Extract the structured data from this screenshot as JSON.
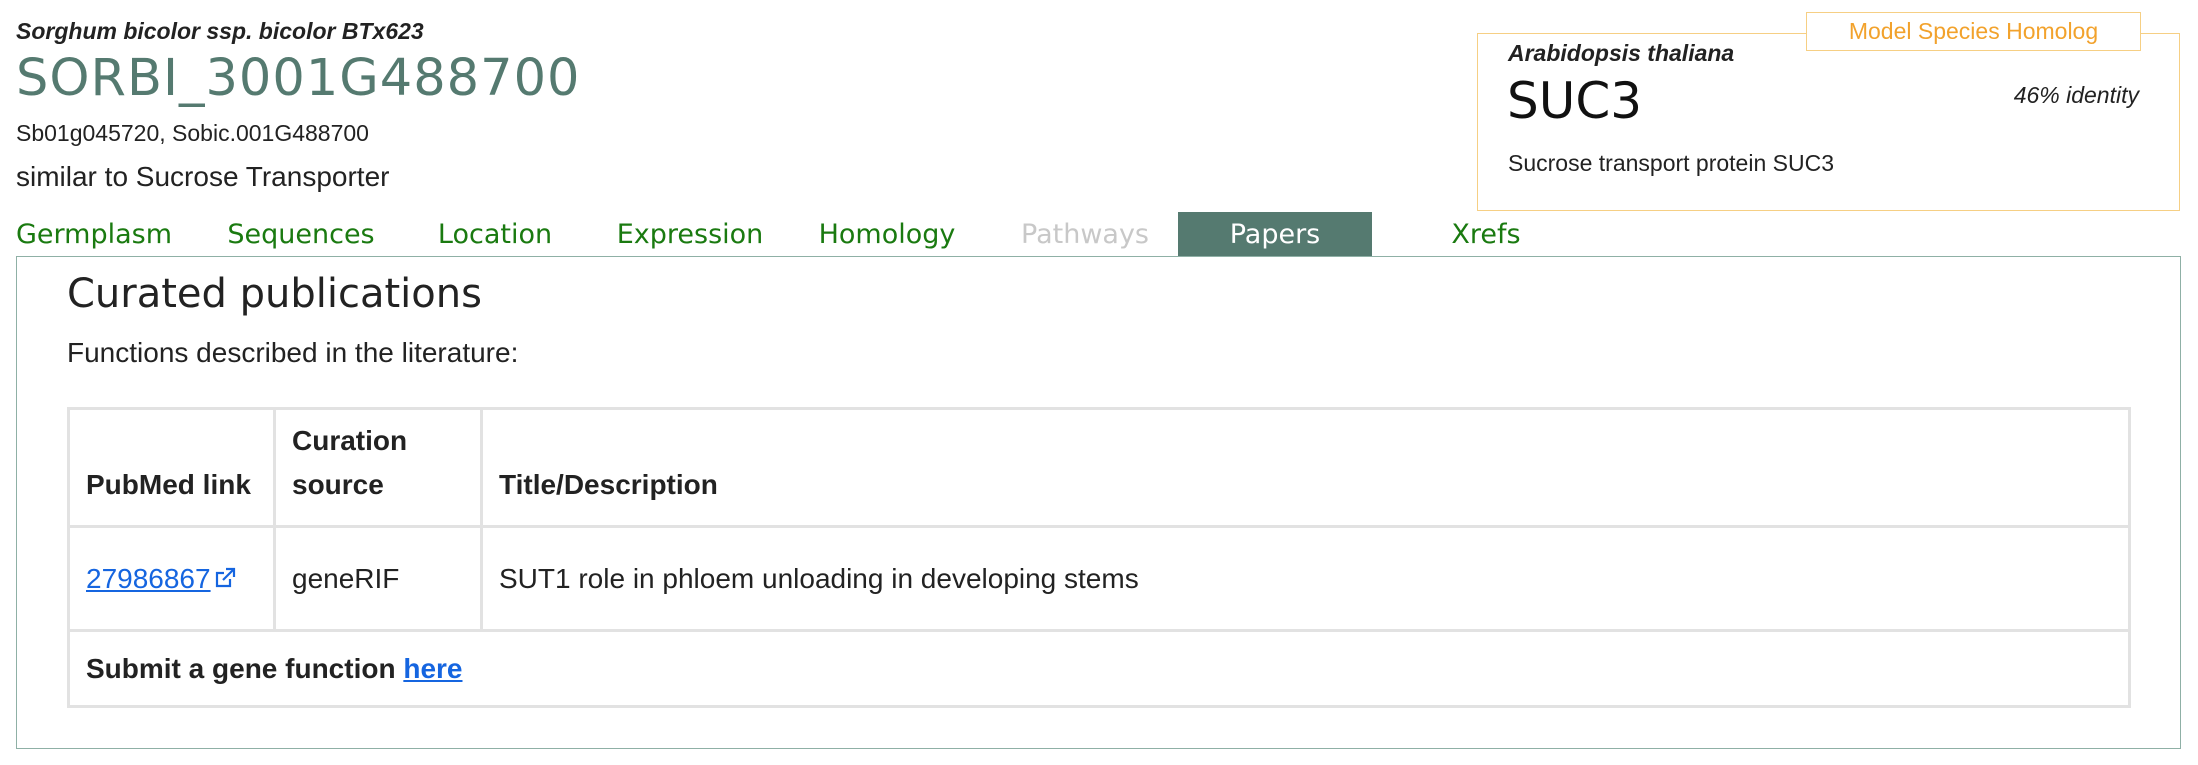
{
  "gene": {
    "species": "Sorghum bicolor ssp. bicolor BTx623",
    "id": "SORBI_3001G488700",
    "synonyms": "Sb01g045720, Sobic.001G488700",
    "summary": "similar to Sucrose Transporter"
  },
  "homolog": {
    "label": "Model Species Homolog",
    "species": "Arabidopsis thaliana",
    "name": "SUC3",
    "identity": "46% identity",
    "description": "Sucrose transport protein SUC3"
  },
  "tabs": [
    {
      "label": "Germplasm",
      "state": "enabled"
    },
    {
      "label": "Sequences",
      "state": "enabled"
    },
    {
      "label": "Location",
      "state": "enabled"
    },
    {
      "label": "Expression",
      "state": "enabled"
    },
    {
      "label": "Homology",
      "state": "enabled"
    },
    {
      "label": "Pathways",
      "state": "disabled"
    },
    {
      "label": "Papers",
      "state": "active"
    },
    {
      "label": "Xrefs",
      "state": "enabled"
    }
  ],
  "papers": {
    "title": "Curated publications",
    "subtitle": "Functions described in the literature:",
    "columns": [
      "PubMed link",
      "Curation source",
      "Title/Description"
    ],
    "rows": [
      {
        "pubmed": "27986867",
        "source": "geneRIF",
        "description": "SUT1 role in phloem unloading in developing stems"
      }
    ],
    "footer_text": "Submit a gene function",
    "footer_link": "here"
  },
  "icons": {
    "external_link": "external-link-icon"
  },
  "colors": {
    "accent": "#557a70",
    "tab_link": "#1a7a10",
    "tab_disabled": "#c8c8c8",
    "homolog_border": "#f6cf84",
    "homolog_label": "#f2a22c",
    "link": "#1565e0"
  }
}
